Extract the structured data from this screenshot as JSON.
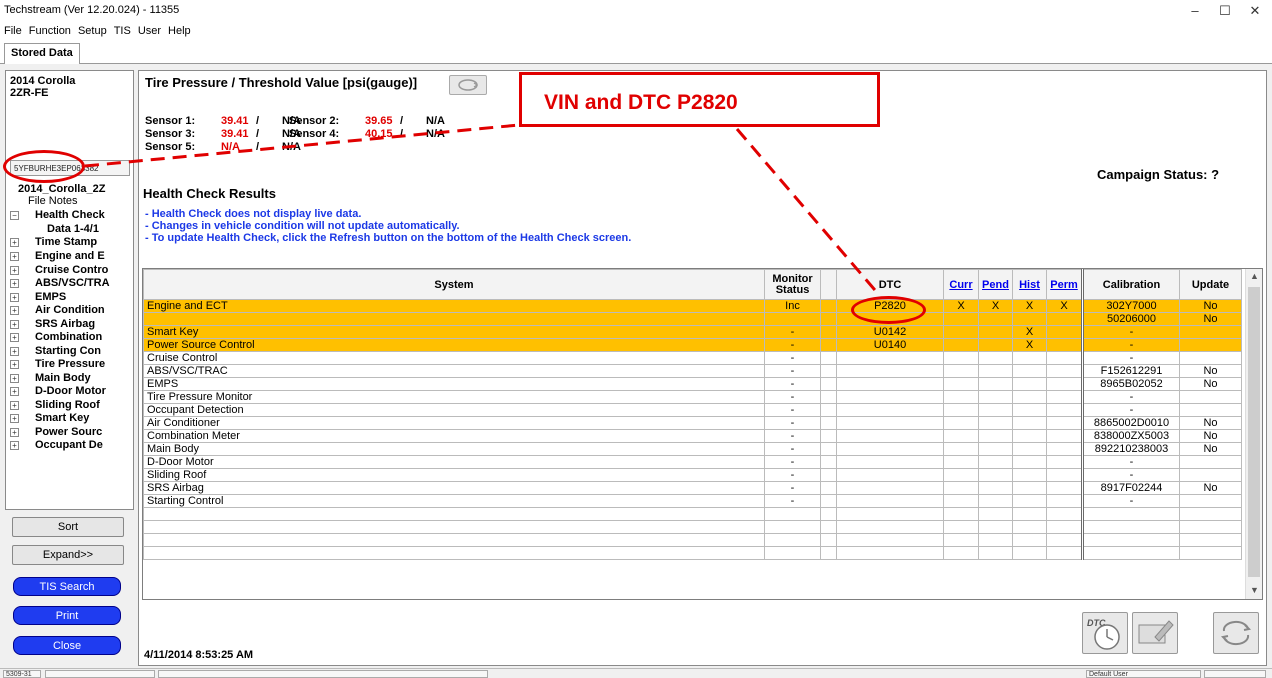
{
  "window": {
    "title": "Techstream (Ver 12.20.024) - 11355",
    "minimize": "–",
    "restore": "☐",
    "close": "✕"
  },
  "menu": [
    "File",
    "Function",
    "Setup",
    "TIS",
    "User",
    "Help"
  ],
  "tab": "Stored Data",
  "left": {
    "vehicle_line1": "2014 Corolla",
    "vehicle_line2": "2ZR-FE",
    "vin": "5YFBURHE3EP063382",
    "tree": [
      {
        "label": "2014_Corolla_2Z",
        "pm": "",
        "bold": true
      },
      {
        "label": "File Notes",
        "pm": "",
        "bold": false
      },
      {
        "label": "Health Check",
        "pm": "−",
        "bold": true
      },
      {
        "label": "Data 1-4/1",
        "pm": "",
        "bold": true
      },
      {
        "label": "Time Stamp",
        "pm": "+",
        "bold": true
      },
      {
        "label": "Engine and E",
        "pm": "+",
        "bold": true
      },
      {
        "label": "Cruise Contro",
        "pm": "+",
        "bold": true
      },
      {
        "label": "ABS/VSC/TRA",
        "pm": "+",
        "bold": true
      },
      {
        "label": "EMPS",
        "pm": "+",
        "bold": true
      },
      {
        "label": "Air Condition",
        "pm": "+",
        "bold": true
      },
      {
        "label": "SRS Airbag",
        "pm": "+",
        "bold": true
      },
      {
        "label": "Combination",
        "pm": "+",
        "bold": true
      },
      {
        "label": "Starting Con",
        "pm": "+",
        "bold": true
      },
      {
        "label": "Tire Pressure",
        "pm": "+",
        "bold": true
      },
      {
        "label": "Main Body",
        "pm": "+",
        "bold": true
      },
      {
        "label": "D-Door Motor",
        "pm": "+",
        "bold": true
      },
      {
        "label": "Sliding Roof",
        "pm": "+",
        "bold": true
      },
      {
        "label": "Smart Key",
        "pm": "+",
        "bold": true
      },
      {
        "label": "Power Sourc",
        "pm": "+",
        "bold": true
      },
      {
        "label": "Occupant De",
        "pm": "+",
        "bold": true
      }
    ],
    "sort": "Sort",
    "expand": "Expand>>",
    "tis_search": "TIS Search",
    "print": "Print",
    "close": "Close"
  },
  "tire": {
    "title": "Tire Pressure / Threshold Value [psi(gauge)]",
    "sensors": [
      {
        "label": "Sensor 1:",
        "value": "39.41",
        "sep": "/",
        "threshold": "N/A"
      },
      {
        "label": "Sensor 2:",
        "value": "39.65",
        "sep": "/",
        "threshold": "N/A"
      },
      {
        "label": "Sensor 3:",
        "value": "39.41",
        "sep": "/",
        "threshold": "N/A"
      },
      {
        "label": "Sensor 4:",
        "value": "40.15",
        "sep": "/",
        "threshold": "N/A"
      },
      {
        "label": "Sensor 5:",
        "value": "N/A",
        "sep": "/",
        "threshold": "N/A"
      }
    ]
  },
  "campaign": "Campaign Status: ?",
  "health": {
    "title": "Health Check Results",
    "notes": [
      "- Health Check does not display live data.",
      "- Changes in vehicle condition will not update automatically.",
      "- To update Health Check, click the Refresh button on the bottom of the Health Check screen."
    ],
    "columns": {
      "system": "System",
      "monitor": "Monitor Status",
      "dtc": "DTC",
      "curr": "Curr",
      "pend": "Pend",
      "hist": "Hist",
      "perm": "Perm",
      "calibration": "Calibration",
      "update": "Update"
    },
    "rows": [
      {
        "system": "Engine and ECT",
        "monitor": "Inc",
        "dtc": "P2820",
        "curr": "X",
        "pend": "X",
        "hist": "X",
        "perm": "X",
        "calibration": "302Y7000",
        "update": "No",
        "hl": true
      },
      {
        "system": "",
        "monitor": "",
        "dtc": "",
        "curr": "",
        "pend": "",
        "hist": "",
        "perm": "",
        "calibration": "50206000",
        "update": "No",
        "hl": true
      },
      {
        "system": "Smart Key",
        "monitor": "-",
        "dtc": "U0142",
        "curr": "",
        "pend": "",
        "hist": "X",
        "perm": "",
        "calibration": "-",
        "update": "",
        "hl": true
      },
      {
        "system": "Power Source Control",
        "monitor": "-",
        "dtc": "U0140",
        "curr": "",
        "pend": "",
        "hist": "X",
        "perm": "",
        "calibration": "-",
        "update": "",
        "hl": true
      },
      {
        "system": "Cruise Control",
        "monitor": "-",
        "dtc": "",
        "curr": "",
        "pend": "",
        "hist": "",
        "perm": "",
        "calibration": "-",
        "update": ""
      },
      {
        "system": "ABS/VSC/TRAC",
        "monitor": "-",
        "dtc": "",
        "curr": "",
        "pend": "",
        "hist": "",
        "perm": "",
        "calibration": "F152612291",
        "update": "No"
      },
      {
        "system": "EMPS",
        "monitor": "-",
        "dtc": "",
        "curr": "",
        "pend": "",
        "hist": "",
        "perm": "",
        "calibration": "8965B02052",
        "update": "No"
      },
      {
        "system": "Tire Pressure Monitor",
        "monitor": "-",
        "dtc": "",
        "curr": "",
        "pend": "",
        "hist": "",
        "perm": "",
        "calibration": "-",
        "update": ""
      },
      {
        "system": "Occupant Detection",
        "monitor": "-",
        "dtc": "",
        "curr": "",
        "pend": "",
        "hist": "",
        "perm": "",
        "calibration": "-",
        "update": ""
      },
      {
        "system": "Air Conditioner",
        "monitor": "-",
        "dtc": "",
        "curr": "",
        "pend": "",
        "hist": "",
        "perm": "",
        "calibration": "8865002D0010",
        "update": "No"
      },
      {
        "system": "Combination Meter",
        "monitor": "-",
        "dtc": "",
        "curr": "",
        "pend": "",
        "hist": "",
        "perm": "",
        "calibration": "838000ZX5003",
        "update": "No"
      },
      {
        "system": "Main Body",
        "monitor": "-",
        "dtc": "",
        "curr": "",
        "pend": "",
        "hist": "",
        "perm": "",
        "calibration": "892210238003",
        "update": "No"
      },
      {
        "system": "D-Door Motor",
        "monitor": "-",
        "dtc": "",
        "curr": "",
        "pend": "",
        "hist": "",
        "perm": "",
        "calibration": "-",
        "update": ""
      },
      {
        "system": "Sliding Roof",
        "monitor": "-",
        "dtc": "",
        "curr": "",
        "pend": "",
        "hist": "",
        "perm": "",
        "calibration": "-",
        "update": ""
      },
      {
        "system": "SRS Airbag",
        "monitor": "-",
        "dtc": "",
        "curr": "",
        "pend": "",
        "hist": "",
        "perm": "",
        "calibration": "8917F02244",
        "update": "No"
      },
      {
        "system": "Starting Control",
        "monitor": "-",
        "dtc": "",
        "curr": "",
        "pend": "",
        "hist": "",
        "perm": "",
        "calibration": "-",
        "update": ""
      },
      {
        "system": "",
        "monitor": "",
        "dtc": "",
        "curr": "",
        "pend": "",
        "hist": "",
        "perm": "",
        "calibration": "",
        "update": ""
      },
      {
        "system": "",
        "monitor": "",
        "dtc": "",
        "curr": "",
        "pend": "",
        "hist": "",
        "perm": "",
        "calibration": "",
        "update": ""
      },
      {
        "system": "",
        "monitor": "",
        "dtc": "",
        "curr": "",
        "pend": "",
        "hist": "",
        "perm": "",
        "calibration": "",
        "update": ""
      },
      {
        "system": "",
        "monitor": "",
        "dtc": "",
        "curr": "",
        "pend": "",
        "hist": "",
        "perm": "",
        "calibration": "",
        "update": ""
      }
    ]
  },
  "datetime": "4/11/2014 8:53:25 AM",
  "icons": {
    "dtc_label": "DTC"
  },
  "status": {
    "left": "5309-31",
    "user": "Default User"
  },
  "annotation": {
    "text": "VIN and DTC P2820",
    "color": "#e00000"
  },
  "colors": {
    "highlight": "#ffc000",
    "accent_blue": "#1f3cf0",
    "note_blue": "#1c39e6",
    "value_red": "#e00000"
  }
}
